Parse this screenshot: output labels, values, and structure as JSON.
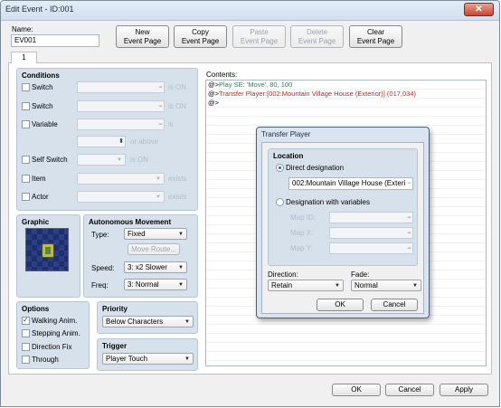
{
  "window": {
    "title": "Edit Event - ID:001",
    "close_glyph": "✕"
  },
  "name_label": "Name:",
  "name_value": "EV001",
  "toolbar": {
    "new_page": [
      "New",
      "Event Page"
    ],
    "copy_page": [
      "Copy",
      "Event Page"
    ],
    "paste_page": [
      "Paste",
      "Event Page"
    ],
    "delete_page": [
      "Delete",
      "Event Page"
    ],
    "clear_page": [
      "Clear",
      "Event Page"
    ]
  },
  "tabs": [
    {
      "label": "1"
    }
  ],
  "conditions": {
    "title": "Conditions",
    "switch1_label": "Switch",
    "switch2_label": "Switch",
    "variable_label": "Variable",
    "self_switch_label": "Self Switch",
    "item_label": "Item",
    "actor_label": "Actor",
    "is_on": "is ON",
    "is": "is",
    "or_above": "or above",
    "exists": "exists"
  },
  "graphic": {
    "title": "Graphic"
  },
  "autonomous": {
    "title": "Autonomous Movement",
    "type_label": "Type:",
    "type_value": "Fixed",
    "move_route_label": "Move Route...",
    "speed_label": "Speed:",
    "speed_value": "3: x2 Slower",
    "freq_label": "Freq:",
    "freq_value": "3: Normal"
  },
  "options": {
    "title": "Options",
    "walking": "Walking Anim.",
    "stepping": "Stepping Anim.",
    "direction_fix": "Direction Fix",
    "through": "Through",
    "walking_checked": true
  },
  "priority": {
    "title": "Priority",
    "value": "Below Characters"
  },
  "trigger": {
    "title": "Trigger",
    "value": "Player Touch"
  },
  "contents": {
    "label": "Contents:",
    "lines": [
      {
        "prefix": "@>",
        "text": "Play SE: 'Move', 80, 100",
        "color": "#1d8a3a"
      },
      {
        "prefix": "@>",
        "text": "Transfer Player:[002:Mountain Village House (Exterior)] (017,034)",
        "color": "#b02a20"
      },
      {
        "prefix": "@>",
        "text": "",
        "color": "#000000"
      }
    ]
  },
  "dialog": {
    "title": "Transfer Player",
    "location_title": "Location",
    "direct_label": "Direct designation",
    "direct_value": "002:Mountain Village House (Exteri",
    "vars_label": "Designation with variables",
    "map_id_label": "Map ID:",
    "map_x_label": "Map X:",
    "map_y_label": "Map Y:",
    "direction_label": "Direction:",
    "direction_value": "Retain",
    "fade_label": "Fade:",
    "fade_value": "Normal",
    "ok_label": "OK",
    "cancel_label": "Cancel",
    "dots": "···"
  },
  "footer": {
    "ok_label": "OK",
    "cancel_label": "Cancel",
    "apply_label": "Apply"
  },
  "arrow_glyph": "▼",
  "spin_glyph": "⬍"
}
